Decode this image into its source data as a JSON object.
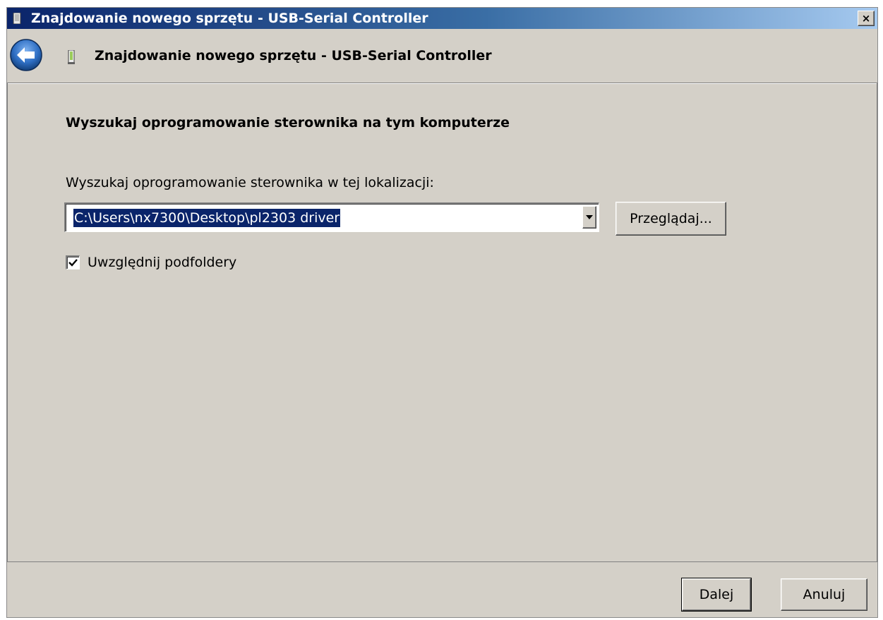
{
  "window": {
    "title": "Znajdowanie nowego sprzętu - USB-Serial Controller",
    "close_label": "×"
  },
  "header": {
    "title": "Znajdowanie nowego sprzętu - USB-Serial Controller"
  },
  "content": {
    "heading": "Wyszukaj oprogramowanie sterownika na tym komputerze",
    "location_label": "Wyszukaj oprogramowanie sterownika w tej lokalizacji:",
    "path_value": "C:\\Users\\nx7300\\Desktop\\pl2303 driver",
    "browse_label": "Przeglądaj...",
    "include_subfolders_label": "Uwzględnij podfoldery",
    "include_subfolders_checked": true
  },
  "footer": {
    "next_label": "Dalej",
    "cancel_label": "Anuluj"
  },
  "icons": {
    "window_icon": "usb-device-icon",
    "back": "back-arrow-icon",
    "header_icon": "usb-device-icon",
    "dropdown": "chevron-down-icon",
    "check": "checkmark-icon"
  },
  "colors": {
    "titlebar_start": "#0a246a",
    "titlebar_end": "#a6caf0",
    "dialog_bg": "#d4d0c8",
    "selection_bg": "#0a246a",
    "back_button": "#2f6fc4"
  }
}
